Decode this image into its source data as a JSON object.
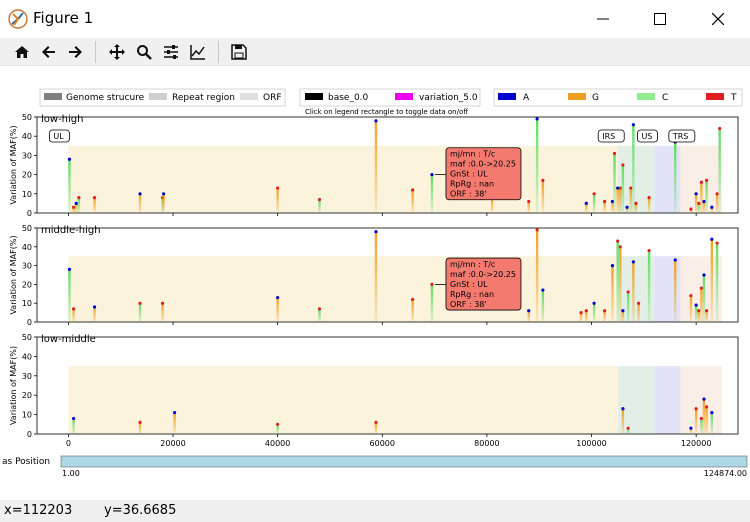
{
  "window": {
    "title": "Figure 1"
  },
  "toolbar": {
    "buttons": [
      {
        "name": "home-icon"
      },
      {
        "name": "back-arrow-icon"
      },
      {
        "name": "forward-arrow-icon"
      },
      {
        "name": "pan-icon"
      },
      {
        "name": "zoom-icon"
      },
      {
        "name": "subplots-config-icon"
      },
      {
        "name": "axes-edit-icon"
      },
      {
        "name": "save-icon"
      }
    ]
  },
  "legends": {
    "region": [
      "Genome strucure",
      "Repeat region",
      "ORF"
    ],
    "data": [
      "base_0.0",
      "variation_5.0"
    ],
    "hint": "Click on legend rectangle to toggle data on/off",
    "bases": [
      {
        "label": "A",
        "color": "#0000cc"
      },
      {
        "label": "G",
        "color": "#f0a020"
      },
      {
        "label": "C",
        "color": "#90ee90"
      },
      {
        "label": "T",
        "color": "#e02020"
      }
    ]
  },
  "chart_data": [
    {
      "type": "bar",
      "title": "low-high",
      "ylabel": "Variation of MAF(%)",
      "ylim": [
        0,
        50
      ],
      "yticks": [
        "0",
        "10",
        "20",
        "30",
        "40",
        "50"
      ],
      "annotations": [
        "UL",
        "IRS",
        "US",
        "TRS"
      ],
      "tooltip": [
        "mj/mn : T/c",
        "maf :0.0->20.25",
        "GnSt : UL",
        "RpRg : nan",
        "ORF : 38'"
      ],
      "x": [
        200,
        1000,
        1500,
        2000,
        5000,
        13700,
        18000,
        18200,
        40000,
        48000,
        58800,
        65800,
        69500,
        81000,
        88000,
        89600,
        90700,
        99000,
        100500,
        102500,
        104000,
        104400,
        105000,
        105500,
        106000,
        106800,
        107500,
        108000,
        108500,
        111000,
        116000,
        119000,
        120000,
        120500,
        121000,
        121500,
        122000,
        123000,
        124000,
        124500
      ],
      "values": [
        28,
        3,
        5,
        8,
        8,
        10,
        8,
        10,
        13,
        7,
        48,
        12,
        20,
        8,
        6,
        49,
        17,
        5,
        10,
        6,
        6,
        31,
        13,
        13,
        25,
        3,
        13,
        46,
        5,
        8,
        37,
        2,
        10,
        5,
        16,
        6,
        17,
        3,
        10,
        44
      ]
    },
    {
      "type": "bar",
      "title": "middle-high",
      "ylabel": "Variation of MAF(%)",
      "ylim": [
        0,
        50
      ],
      "yticks": [
        "0",
        "10",
        "20",
        "30",
        "40",
        "50"
      ],
      "tooltip": [
        "mj/mn : T/c",
        "maf :0.0->20.25",
        "GnSt : UL",
        "RpRg : nan",
        "ORF : 38'"
      ],
      "x": [
        200,
        1000,
        5000,
        13700,
        18000,
        40000,
        48000,
        58800,
        65800,
        69500,
        88000,
        89600,
        90700,
        98000,
        99000,
        100500,
        102500,
        104000,
        105000,
        105500,
        106000,
        107000,
        108000,
        109000,
        111000,
        116000,
        119000,
        120000,
        120500,
        121000,
        121500,
        122000,
        123000,
        124000
      ],
      "values": [
        28,
        7,
        8,
        10,
        10,
        13,
        7,
        48,
        12,
        20,
        6,
        49,
        17,
        5,
        6,
        10,
        6,
        30,
        43,
        40,
        6,
        16,
        32,
        10,
        38,
        33,
        14,
        9,
        6,
        18,
        25,
        6,
        44,
        42
      ]
    },
    {
      "type": "bar",
      "title": "low-middle",
      "ylabel": "Variation of MAF(%)",
      "ylim": [
        0,
        50
      ],
      "xticks": [
        "0",
        "20000",
        "40000",
        "60000",
        "80000",
        "100000",
        "120000"
      ],
      "x": [
        1000,
        13700,
        20300,
        40000,
        58800,
        106000,
        107000,
        119000,
        120000,
        121000,
        121500,
        122000,
        123000
      ],
      "values": [
        8,
        6,
        11,
        5,
        6,
        13,
        3,
        3,
        13,
        8,
        18,
        14,
        11
      ]
    }
  ],
  "slider": {
    "label": "as Position",
    "min_label": "1.00",
    "max_label": "124874.00"
  },
  "status": {
    "x": "x=112203",
    "y": "y=36.6685"
  }
}
